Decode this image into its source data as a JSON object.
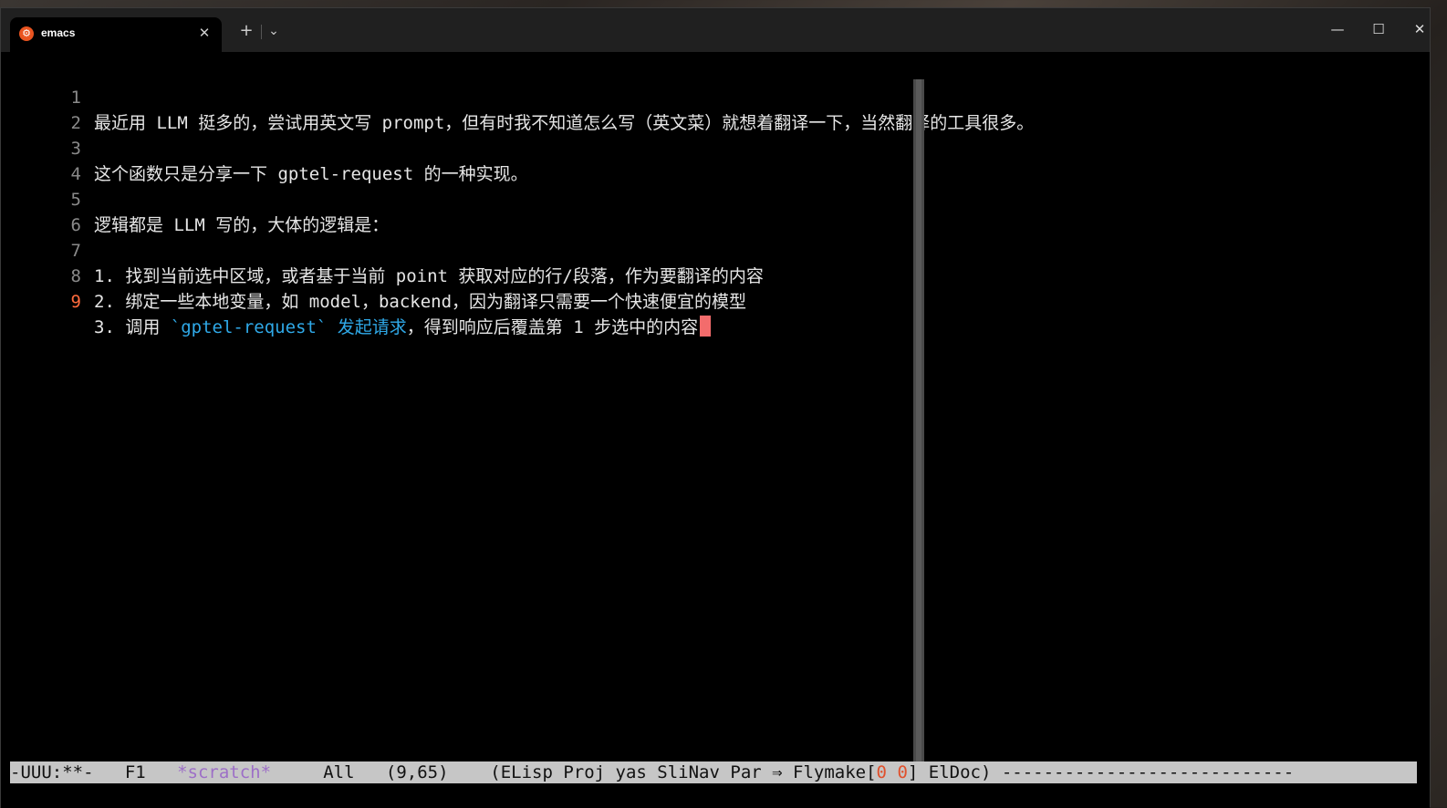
{
  "titlebar": {
    "tab_icon_glyph": "⚙",
    "tab_title": "emacs",
    "tab_close": "✕",
    "new_tab": "+",
    "dropdown": "⌄",
    "minimize": "—",
    "maximize": "☐",
    "close": "✕"
  },
  "editor": {
    "lines": [
      {
        "num": "1",
        "text": "最近用 LLM 挺多的，尝试用英文写 prompt，但有时我不知道怎么写（英文菜）就想着翻译一下，当然翻译的工具很多。"
      },
      {
        "num": "2",
        "text": ""
      },
      {
        "num": "3",
        "text": "这个函数只是分享一下 gptel-request 的一种实现。"
      },
      {
        "num": "4",
        "text": ""
      },
      {
        "num": "5",
        "text": "逻辑都是 LLM 写的，大体的逻辑是："
      },
      {
        "num": "6",
        "text": ""
      },
      {
        "num": "7",
        "text": "1. 找到当前选中区域，或者基于当前 point 获取对应的行/段落，作为要翻译的内容"
      },
      {
        "num": "8",
        "text": "2. 绑定一些本地变量，如 model，backend，因为翻译只需要一个快速便宜的模型"
      },
      {
        "num": "9",
        "prefix": "3. 调用 ",
        "code": "`gptel-request` 发起请求",
        "suffix": "，得到响应后覆盖第 1 步选中的内容"
      }
    ]
  },
  "modeline": {
    "status": "-UUU:**-",
    "frame": "F1",
    "buffer": "*scratch*",
    "position": "All",
    "cursor": "(9,65)",
    "modes_prefix": "(ELisp Proj yas SliNav Par ⇒ Flymake[",
    "flymake_errors": "0",
    "flymake_warnings": "0",
    "modes_suffix": "] ElDoc)",
    "tail": "----------------------------"
  },
  "colors": {
    "code": "#2fa9e8",
    "cursor": "#f36c6c",
    "current_line_number": "#ff6b3d",
    "buffer_name": "#9d6fc7"
  }
}
